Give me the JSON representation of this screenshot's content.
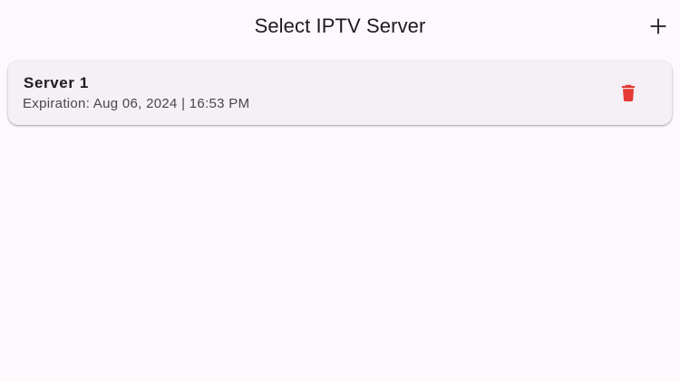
{
  "header": {
    "title": "Select IPTV Server",
    "add_icon": "plus-icon"
  },
  "servers": [
    {
      "name": "Server 1",
      "expiration": "Expiration: Aug 06, 2024 | 16:53 PM",
      "delete_icon": "trash-icon"
    }
  ],
  "colors": {
    "background": "#fcf8fc",
    "card": "#f4f0f5",
    "delete": "#e53935",
    "text": "#1d1b20",
    "secondary_text": "#49454f"
  }
}
